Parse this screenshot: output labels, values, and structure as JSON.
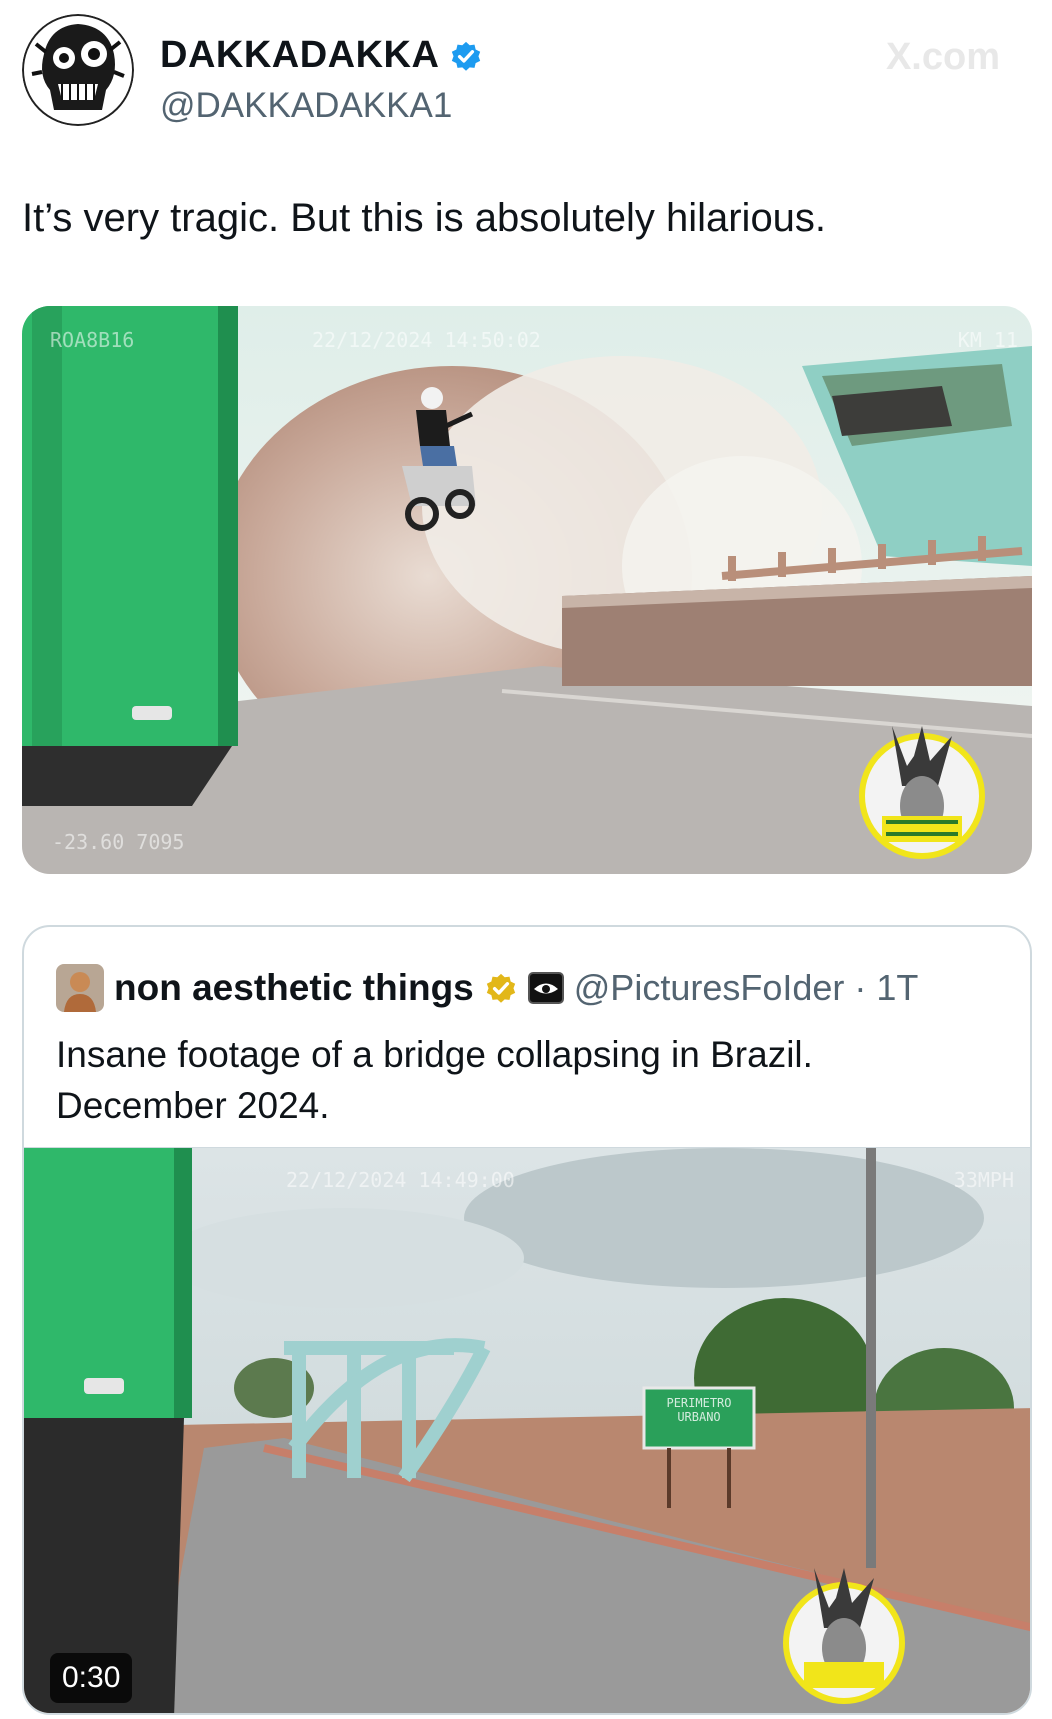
{
  "header": {
    "display_name": "DAKKADAKKA",
    "handle": "@DAKKADAKKA1",
    "watermark": "X.com",
    "verified_color": "#1d9bf0"
  },
  "tweet": {
    "text": "It’s very tragic. But this is absolutely hilarious."
  },
  "media1": {
    "overlay_plate": "ROA8B16",
    "overlay_timestamp": "22/12/2024 14:50:02",
    "overlay_coords": "-23.60 7095",
    "overlay_right": "KM 11"
  },
  "quote": {
    "display_name": "non aesthetic things",
    "handle": "@PicturesFoIder",
    "separator": "·",
    "time": "1T",
    "text_line1": "Insane footage of a bridge collapsing in Brazil.",
    "text_line2": "December 2024.",
    "verified_color": "#e2b719",
    "media": {
      "duration": "0:30",
      "overlay_timestamp": "22/12/2024 14:49:00",
      "overlay_right": "33MPH",
      "sign_text": "PERIMETRO URBANO"
    }
  }
}
